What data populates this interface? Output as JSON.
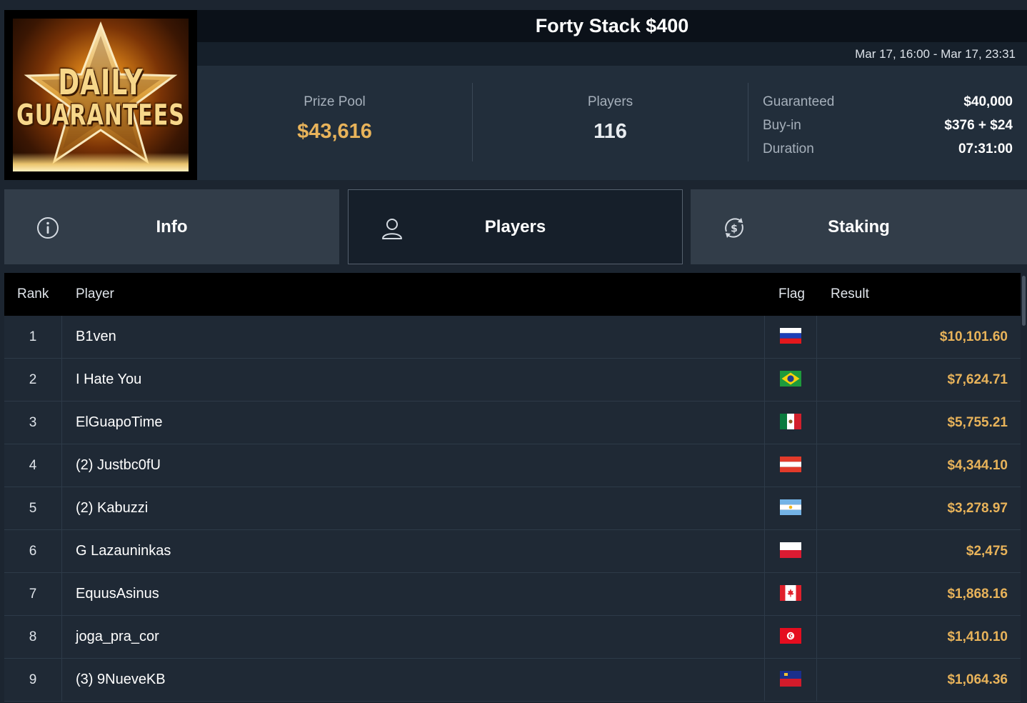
{
  "logo": {
    "line1": "DAILY",
    "line2": "GUARANTEES"
  },
  "tournament": {
    "title": "Forty Stack $400",
    "dates": "Mar 17, 16:00 - Mar 17, 23:31"
  },
  "stats": {
    "prize_pool_label": "Prize Pool",
    "prize_pool_value": "$43,616",
    "players_label": "Players",
    "players_value": "116",
    "details": [
      {
        "label": "Guaranteed",
        "value": "$40,000"
      },
      {
        "label": "Buy-in",
        "value": "$376 + $24"
      },
      {
        "label": "Duration",
        "value": "07:31:00"
      }
    ]
  },
  "tabs": [
    {
      "label": "Info",
      "icon": "info-icon",
      "active": false
    },
    {
      "label": "Players",
      "icon": "user-icon",
      "active": true
    },
    {
      "label": "Staking",
      "icon": "dollar-cycle-icon",
      "active": false
    }
  ],
  "table": {
    "headers": {
      "rank": "Rank",
      "player": "Player",
      "flag": "Flag",
      "result": "Result"
    },
    "rows": [
      {
        "rank": "1",
        "player": "B1ven",
        "flag": "russia",
        "result": "$10,101.60"
      },
      {
        "rank": "2",
        "player": "I Hate You",
        "flag": "brazil",
        "result": "$7,624.71"
      },
      {
        "rank": "3",
        "player": "ElGuapoTime",
        "flag": "mexico",
        "result": "$5,755.21"
      },
      {
        "rank": "4",
        "player": "(2) Justbc0fU",
        "flag": "austria",
        "result": "$4,344.10"
      },
      {
        "rank": "5",
        "player": "(2) Kabuzzi",
        "flag": "argentina",
        "result": "$3,278.97"
      },
      {
        "rank": "6",
        "player": "G Lazauninkas",
        "flag": "poland",
        "result": "$2,475"
      },
      {
        "rank": "7",
        "player": "EquusAsinus",
        "flag": "canada",
        "result": "$1,868.16"
      },
      {
        "rank": "8",
        "player": "joga_pra_cor",
        "flag": "tunisia",
        "result": "$1,410.10"
      },
      {
        "rank": "9",
        "player": "(3) 9NueveKB",
        "flag": "liechtenstein",
        "result": "$1,064.36"
      }
    ]
  },
  "colors": {
    "accent_gold": "#e8b35a",
    "background": "#1c2530",
    "title_bar": "#0b1119"
  }
}
